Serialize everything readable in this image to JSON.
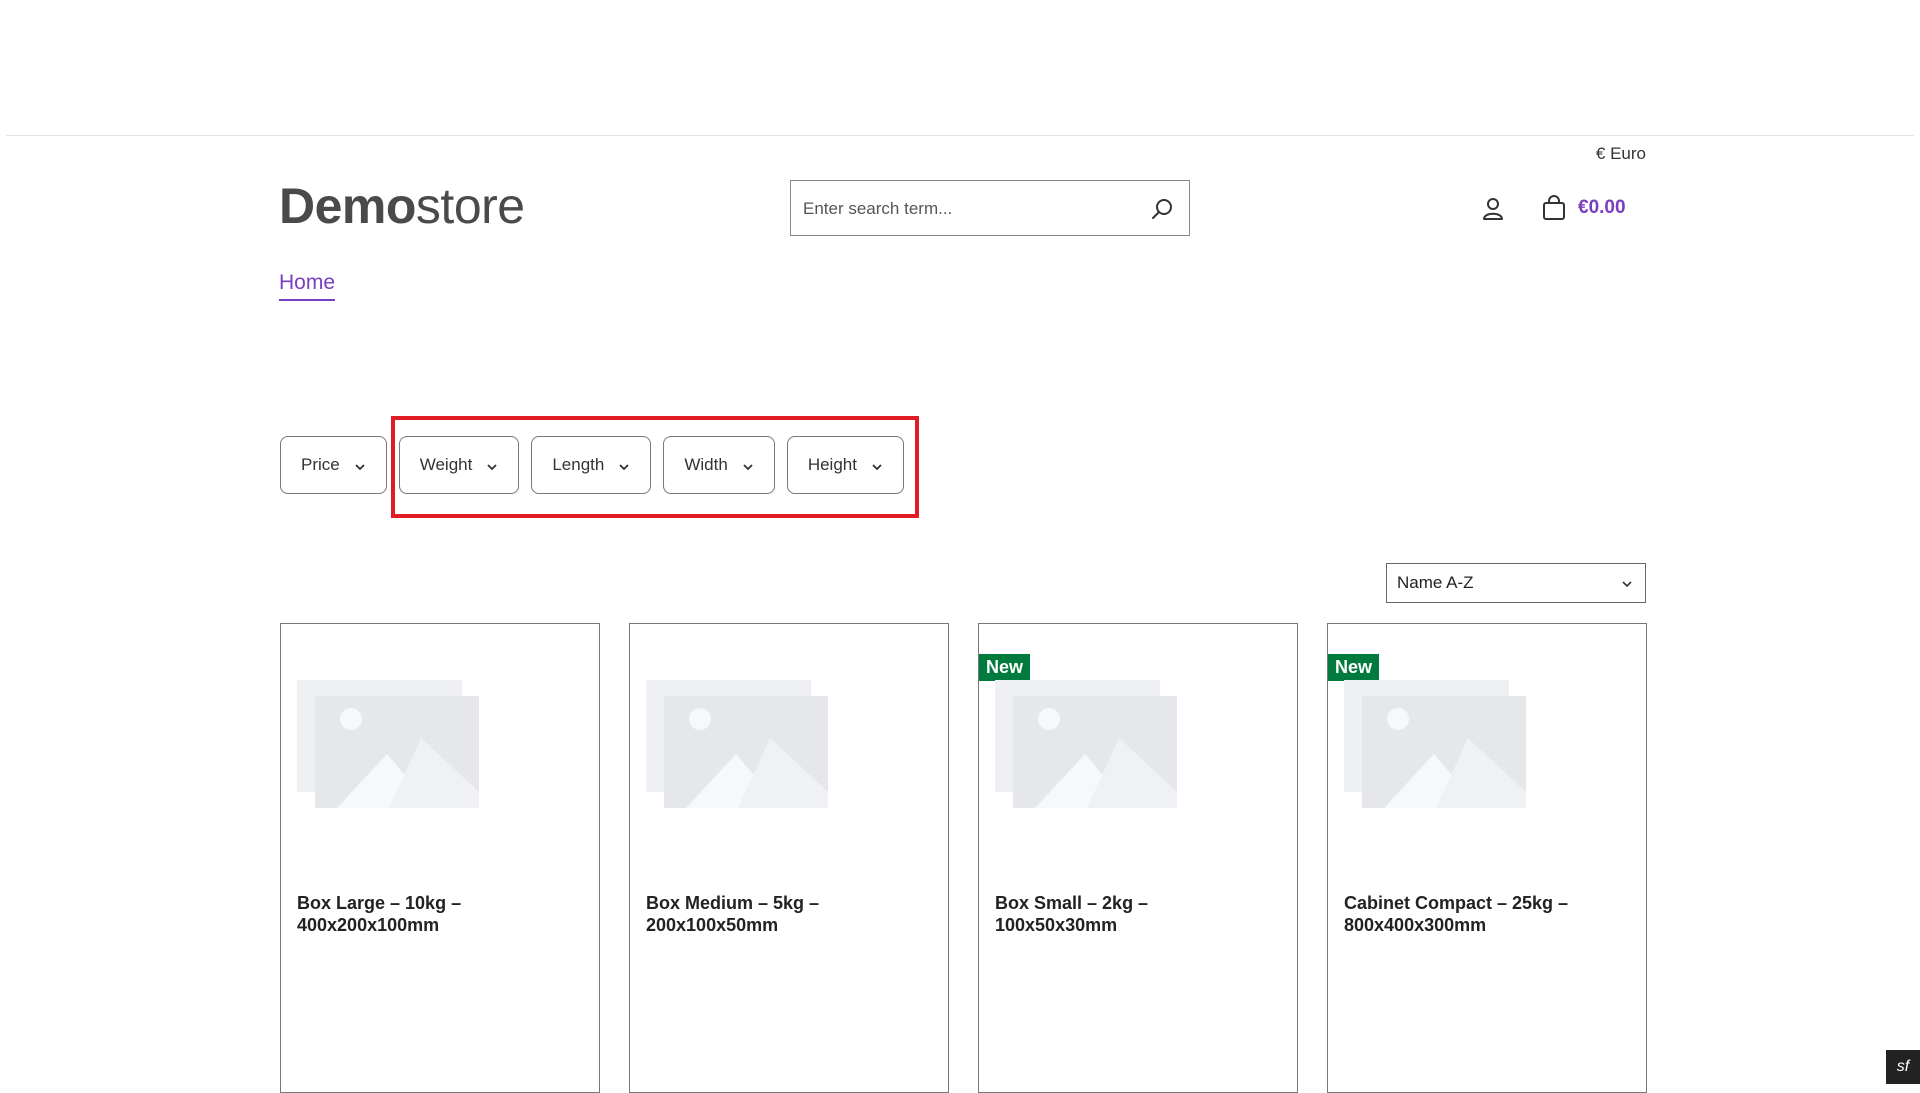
{
  "header": {
    "currency": "€ Euro",
    "logo_bold": "Demo",
    "logo_light": "store",
    "search_placeholder": "Enter search term...",
    "cart_amount": "€0.00"
  },
  "nav": {
    "home": "Home"
  },
  "filters": {
    "price": "Price",
    "weight": "Weight",
    "length": "Length",
    "width": "Width",
    "height": "Height"
  },
  "sort": {
    "selected": "Name A-Z"
  },
  "products": [
    {
      "title": "Box Large – 10kg – 400x200x100mm",
      "badge": ""
    },
    {
      "title": "Box Medium – 5kg – 200x100x50mm",
      "badge": ""
    },
    {
      "title": "Box Small – 2kg – 100x50x30mm",
      "badge": "New"
    },
    {
      "title": "Cabinet Compact – 25kg – 800x400x300mm",
      "badge": "New"
    }
  ],
  "colors": {
    "accent": "#7a3ec2",
    "badge": "#007a3d",
    "highlight": "#e01b24"
  },
  "symfony_label": "sf"
}
